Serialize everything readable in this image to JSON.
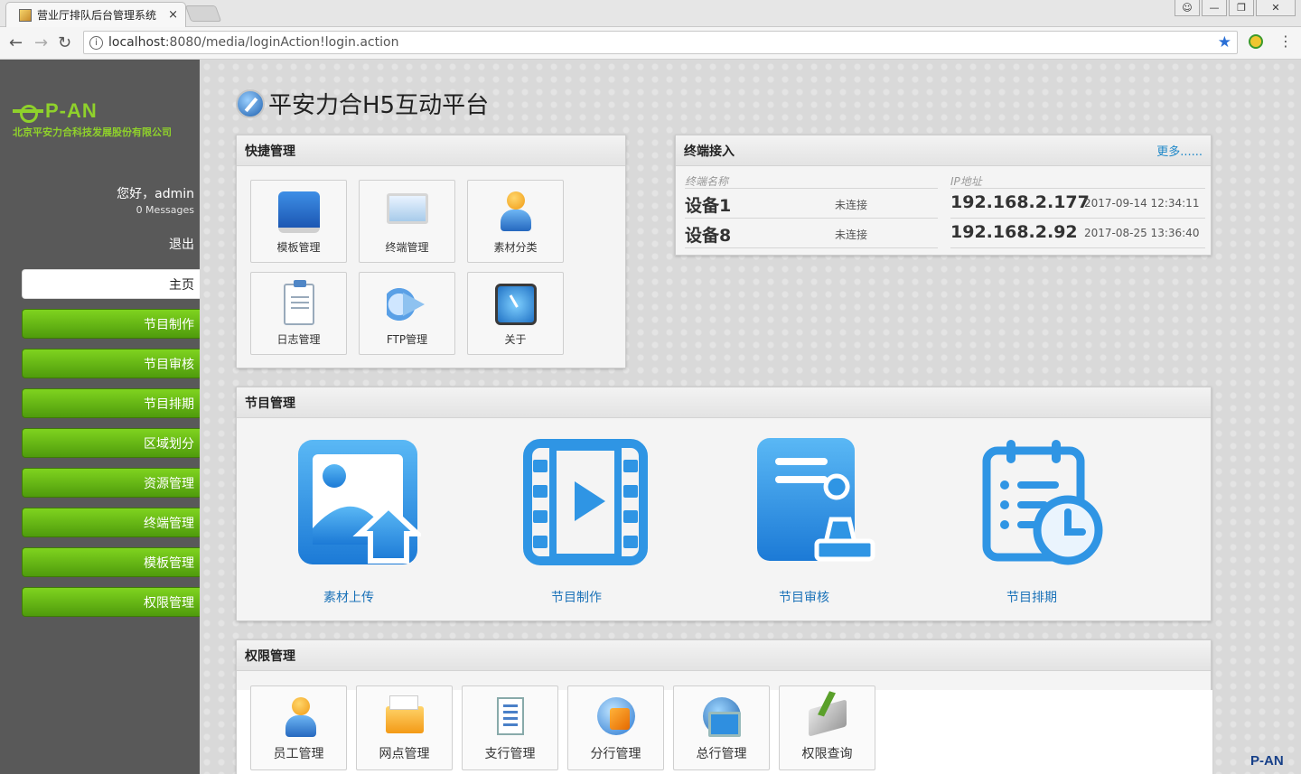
{
  "browser": {
    "tab_title": "营业厅排队后台管理系统",
    "tab_close": "×",
    "url_host": "localhost",
    "url_rest": ":8080/media/loginAction!login.action"
  },
  "sidebar": {
    "logo_text": "P-AN",
    "company": "北京平安力合科技发展股份有限公司",
    "greeting": "您好，admin",
    "messages": "0 Messages",
    "logout": "退出",
    "items": [
      {
        "label": "主页",
        "active": true
      },
      {
        "label": "节目制作"
      },
      {
        "label": "节目审核"
      },
      {
        "label": "节目排期"
      },
      {
        "label": "区域划分"
      },
      {
        "label": "资源管理"
      },
      {
        "label": "终端管理"
      },
      {
        "label": "模板管理"
      },
      {
        "label": "权限管理"
      }
    ]
  },
  "main": {
    "title": "平安力合H5互动平台",
    "quick": {
      "title": "快捷管理",
      "tiles": [
        {
          "label": "模板管理",
          "icon": "book-icon"
        },
        {
          "label": "终端管理",
          "icon": "monitor-icon"
        },
        {
          "label": "素材分类",
          "icon": "user-icon"
        },
        {
          "label": "日志管理",
          "icon": "clipboard-icon"
        },
        {
          "label": "FTP管理",
          "icon": "megaphone-icon"
        },
        {
          "label": "关于",
          "icon": "clock-icon"
        }
      ]
    },
    "terminal": {
      "title": "终端接入",
      "more": "更多......",
      "col_name": "终端名称",
      "col_ip": "IP地址",
      "rows": [
        {
          "name": "设备1",
          "status": "未连接",
          "ip": "192.168.2.177",
          "time": "2017-09-14 12:34:11"
        },
        {
          "name": "设备8",
          "status": "未连接",
          "ip": "192.168.2.92",
          "time": "2017-08-25 13:36:40"
        }
      ]
    },
    "program": {
      "title": "节目管理",
      "items": [
        {
          "label": "素材上传",
          "icon": "image-upload-icon"
        },
        {
          "label": "节目制作",
          "icon": "video-film-icon"
        },
        {
          "label": "节目审核",
          "icon": "document-stamp-icon"
        },
        {
          "label": "节目排期",
          "icon": "calendar-clock-icon"
        }
      ]
    },
    "permission": {
      "title": "权限管理",
      "tiles": [
        {
          "label": "员工管理",
          "icon": "user-icon"
        },
        {
          "label": "网点管理",
          "icon": "folder-icon"
        },
        {
          "label": "支行管理",
          "icon": "document-icon"
        },
        {
          "label": "分行管理",
          "icon": "globe-icon"
        },
        {
          "label": "总行管理",
          "icon": "globe-screen-icon"
        },
        {
          "label": "权限查询",
          "icon": "book-pen-icon"
        }
      ]
    },
    "corner_logo": "P-AN"
  },
  "colors": {
    "sidebar_bg": "#595959",
    "nav_green": "#6cbf17",
    "logo_green": "#8fd12b",
    "link_blue": "#1b72b8",
    "icon_blue": "#2f95e4"
  }
}
